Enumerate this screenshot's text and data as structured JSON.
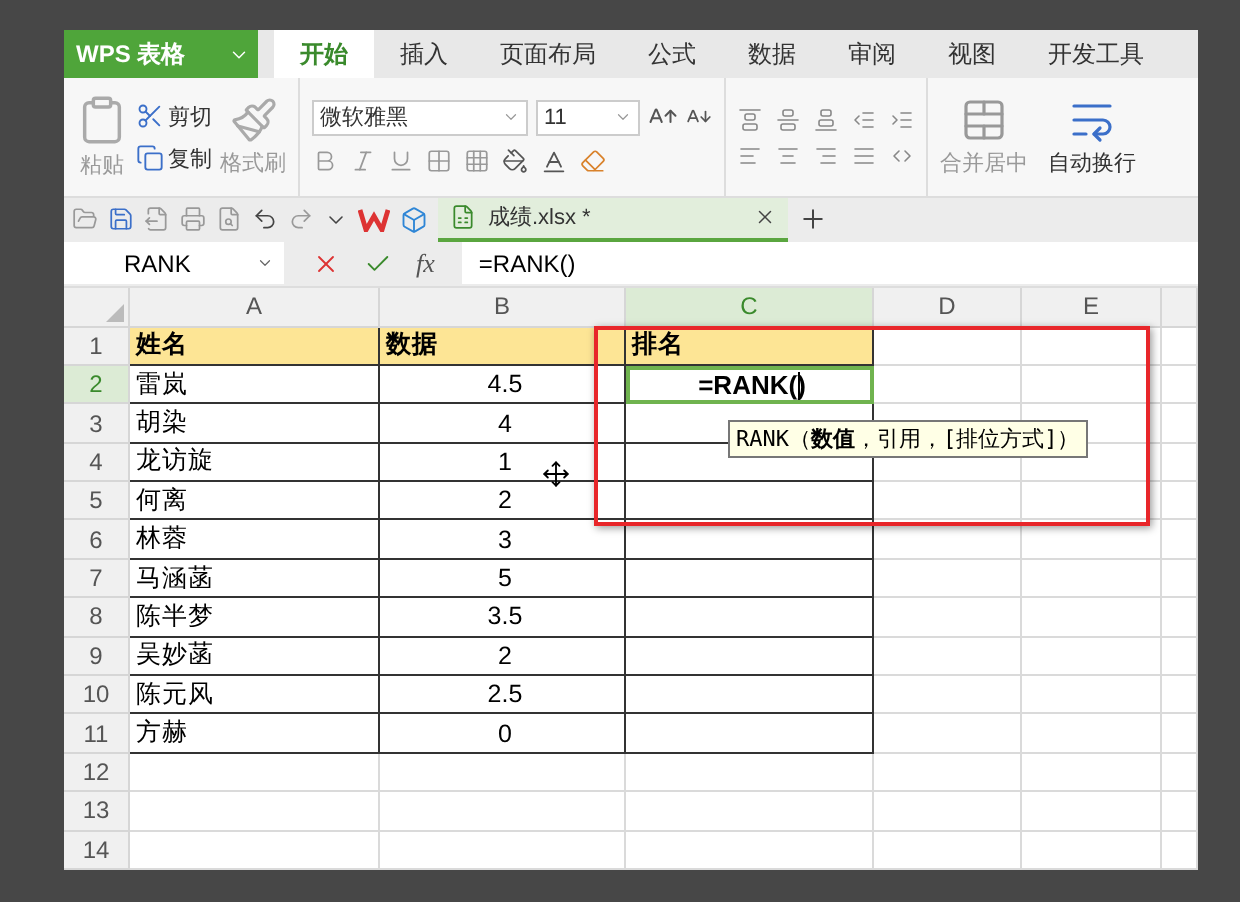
{
  "app": {
    "name": "WPS 表格"
  },
  "tabs": [
    {
      "label": "开始",
      "selected": true
    },
    {
      "label": "插入",
      "selected": false
    },
    {
      "label": "页面布局",
      "selected": false
    },
    {
      "label": "公式",
      "selected": false
    },
    {
      "label": "数据",
      "selected": false
    },
    {
      "label": "审阅",
      "selected": false
    },
    {
      "label": "视图",
      "selected": false
    },
    {
      "label": "开发工具",
      "selected": false
    }
  ],
  "clipboard": {
    "paste": {
      "label": "粘贴",
      "disabled": true
    },
    "cut": {
      "label": "剪切",
      "disabled": false
    },
    "copy": {
      "label": "复制",
      "disabled": false
    },
    "format_painter": {
      "label": "格式刷",
      "disabled": true
    }
  },
  "font": {
    "name": "微软雅黑",
    "size": "11"
  },
  "alignment": {
    "merge": {
      "label": "合并居中",
      "disabled": true
    },
    "wrap": {
      "label": "自动换行",
      "disabled": false
    }
  },
  "document_tab": {
    "name": "成绩.xlsx *"
  },
  "formula_bar": {
    "name_box": "RANK",
    "fx": "fx",
    "formula": "=RANK()"
  },
  "columns": [
    {
      "label": "A",
      "selected": false
    },
    {
      "label": "B",
      "selected": false
    },
    {
      "label": "C",
      "selected": true
    },
    {
      "label": "D",
      "selected": false
    },
    {
      "label": "E",
      "selected": false
    }
  ],
  "rows": [
    {
      "number": "1",
      "selected": false,
      "kind": "header",
      "name": "姓名",
      "value": "数据",
      "rank": "排名"
    },
    {
      "number": "2",
      "selected": true,
      "kind": "data",
      "name": "雷岚",
      "value": "4.5",
      "rank": "=RANK()"
    },
    {
      "number": "3",
      "selected": false,
      "kind": "data",
      "name": "胡染",
      "value": "4"
    },
    {
      "number": "4",
      "selected": false,
      "kind": "data",
      "name": "龙访旋",
      "value": "1"
    },
    {
      "number": "5",
      "selected": false,
      "kind": "data",
      "name": "何离",
      "value": "2"
    },
    {
      "number": "6",
      "selected": false,
      "kind": "data",
      "name": "林蓉",
      "value": "3"
    },
    {
      "number": "7",
      "selected": false,
      "kind": "data",
      "name": "马涵菡",
      "value": "5"
    },
    {
      "number": "8",
      "selected": false,
      "kind": "data",
      "name": "陈半梦",
      "value": "3.5"
    },
    {
      "number": "9",
      "selected": false,
      "kind": "data",
      "name": "吴妙菡",
      "value": "2"
    },
    {
      "number": "10",
      "selected": false,
      "kind": "data",
      "name": "陈元风",
      "value": "2.5"
    },
    {
      "number": "11",
      "selected": false,
      "kind": "data",
      "name": "方赫",
      "value": "0"
    },
    {
      "number": "12",
      "selected": false,
      "kind": "empty"
    },
    {
      "number": "13",
      "selected": false,
      "kind": "empty"
    },
    {
      "number": "14",
      "selected": false,
      "kind": "empty"
    }
  ],
  "tooltip": "RANK（**数值**，引用，[排位方式]）"
}
